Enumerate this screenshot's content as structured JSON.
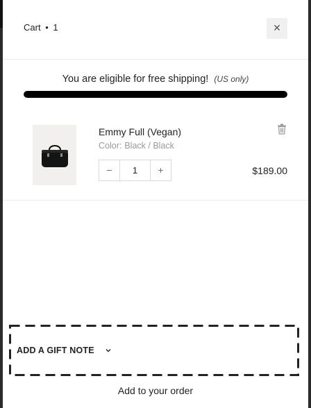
{
  "header": {
    "cart_label": "Cart",
    "separator": "•",
    "item_count": "1",
    "close_icon": "close-icon"
  },
  "shipping": {
    "message": "You are eligible for free shipping!",
    "note": "(US only)",
    "progress": 1.0,
    "progress_color": "#000000"
  },
  "items": [
    {
      "title": "Emmy Full (Vegan)",
      "variant_label": "Color:",
      "variant_value": "Black / Black",
      "quantity": "1",
      "price": "$189.00",
      "image_icon": "handbag-icon",
      "remove_icon": "trash-icon",
      "decrement_icon": "minus-icon",
      "increment_icon": "plus-icon"
    }
  ],
  "footer": {
    "gift_note_label": "ADD A GIFT NOTE",
    "gift_note_icon": "chevron-down-icon",
    "add_to_order": "Add to your order"
  }
}
